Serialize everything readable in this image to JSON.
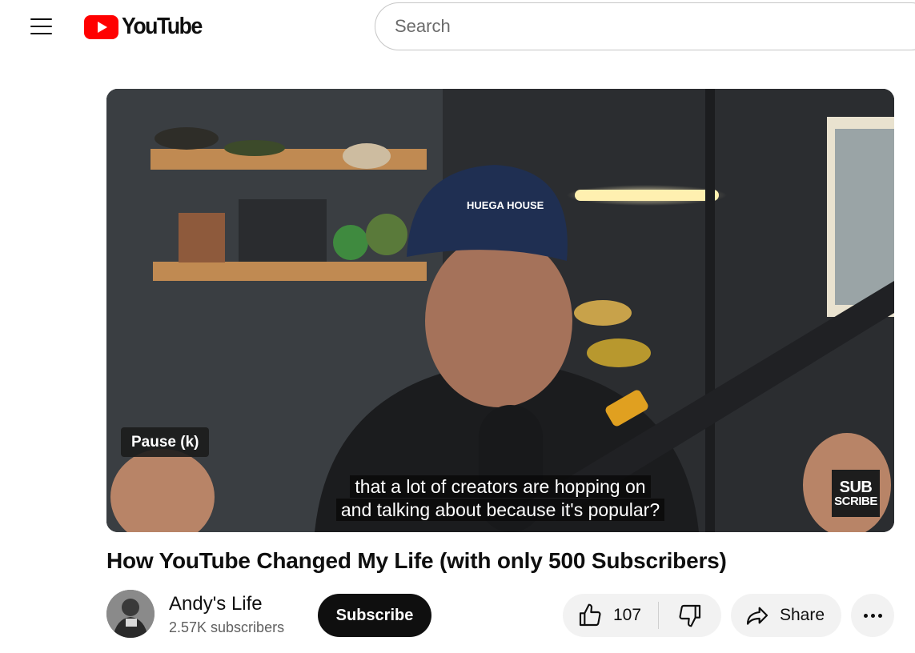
{
  "header": {
    "logo_text": "YouTube",
    "search_placeholder": "Search"
  },
  "player": {
    "tooltip": "Pause (k)",
    "caption_line1": "that a lot of creators are hopping on",
    "caption_line2": "and talking about because it's popular?",
    "badge_line1": "SUB",
    "badge_line2": "SCRIBE"
  },
  "video": {
    "title": "How YouTube Changed My Life (with only 500 Subscribers)"
  },
  "channel": {
    "name": "Andy's Life",
    "subscribers": "2.57K subscribers",
    "subscribe_label": "Subscribe"
  },
  "actions": {
    "like_count": "107",
    "share_label": "Share"
  },
  "colors": {
    "brand_red": "#ff0000",
    "subscribe_bg": "#0f0f0f",
    "chip_bg": "#f2f2f2"
  },
  "icons": [
    "menu-icon",
    "youtube-logo-icon",
    "like-icon",
    "dislike-icon",
    "share-icon",
    "more-icon"
  ]
}
